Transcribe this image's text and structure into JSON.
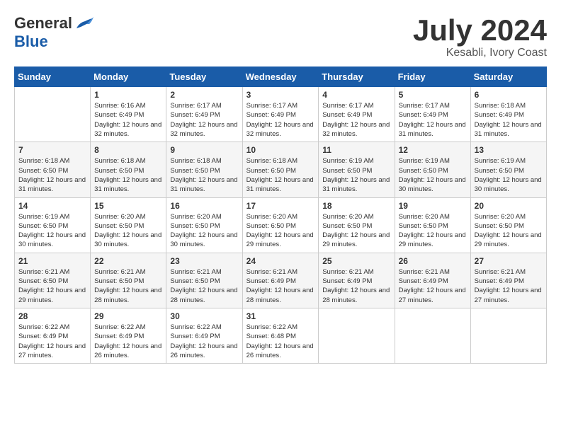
{
  "logo": {
    "general": "General",
    "blue": "Blue"
  },
  "title": {
    "month_year": "July 2024",
    "location": "Kesabli, Ivory Coast"
  },
  "calendar": {
    "headers": [
      "Sunday",
      "Monday",
      "Tuesday",
      "Wednesday",
      "Thursday",
      "Friday",
      "Saturday"
    ],
    "weeks": [
      [
        {
          "day": "",
          "sunrise": "",
          "sunset": "",
          "daylight": ""
        },
        {
          "day": "1",
          "sunrise": "Sunrise: 6:16 AM",
          "sunset": "Sunset: 6:49 PM",
          "daylight": "Daylight: 12 hours and 32 minutes."
        },
        {
          "day": "2",
          "sunrise": "Sunrise: 6:17 AM",
          "sunset": "Sunset: 6:49 PM",
          "daylight": "Daylight: 12 hours and 32 minutes."
        },
        {
          "day": "3",
          "sunrise": "Sunrise: 6:17 AM",
          "sunset": "Sunset: 6:49 PM",
          "daylight": "Daylight: 12 hours and 32 minutes."
        },
        {
          "day": "4",
          "sunrise": "Sunrise: 6:17 AM",
          "sunset": "Sunset: 6:49 PM",
          "daylight": "Daylight: 12 hours and 32 minutes."
        },
        {
          "day": "5",
          "sunrise": "Sunrise: 6:17 AM",
          "sunset": "Sunset: 6:49 PM",
          "daylight": "Daylight: 12 hours and 31 minutes."
        },
        {
          "day": "6",
          "sunrise": "Sunrise: 6:18 AM",
          "sunset": "Sunset: 6:49 PM",
          "daylight": "Daylight: 12 hours and 31 minutes."
        }
      ],
      [
        {
          "day": "7",
          "sunrise": "Sunrise: 6:18 AM",
          "sunset": "Sunset: 6:50 PM",
          "daylight": "Daylight: 12 hours and 31 minutes."
        },
        {
          "day": "8",
          "sunrise": "Sunrise: 6:18 AM",
          "sunset": "Sunset: 6:50 PM",
          "daylight": "Daylight: 12 hours and 31 minutes."
        },
        {
          "day": "9",
          "sunrise": "Sunrise: 6:18 AM",
          "sunset": "Sunset: 6:50 PM",
          "daylight": "Daylight: 12 hours and 31 minutes."
        },
        {
          "day": "10",
          "sunrise": "Sunrise: 6:18 AM",
          "sunset": "Sunset: 6:50 PM",
          "daylight": "Daylight: 12 hours and 31 minutes."
        },
        {
          "day": "11",
          "sunrise": "Sunrise: 6:19 AM",
          "sunset": "Sunset: 6:50 PM",
          "daylight": "Daylight: 12 hours and 31 minutes."
        },
        {
          "day": "12",
          "sunrise": "Sunrise: 6:19 AM",
          "sunset": "Sunset: 6:50 PM",
          "daylight": "Daylight: 12 hours and 30 minutes."
        },
        {
          "day": "13",
          "sunrise": "Sunrise: 6:19 AM",
          "sunset": "Sunset: 6:50 PM",
          "daylight": "Daylight: 12 hours and 30 minutes."
        }
      ],
      [
        {
          "day": "14",
          "sunrise": "Sunrise: 6:19 AM",
          "sunset": "Sunset: 6:50 PM",
          "daylight": "Daylight: 12 hours and 30 minutes."
        },
        {
          "day": "15",
          "sunrise": "Sunrise: 6:20 AM",
          "sunset": "Sunset: 6:50 PM",
          "daylight": "Daylight: 12 hours and 30 minutes."
        },
        {
          "day": "16",
          "sunrise": "Sunrise: 6:20 AM",
          "sunset": "Sunset: 6:50 PM",
          "daylight": "Daylight: 12 hours and 30 minutes."
        },
        {
          "day": "17",
          "sunrise": "Sunrise: 6:20 AM",
          "sunset": "Sunset: 6:50 PM",
          "daylight": "Daylight: 12 hours and 29 minutes."
        },
        {
          "day": "18",
          "sunrise": "Sunrise: 6:20 AM",
          "sunset": "Sunset: 6:50 PM",
          "daylight": "Daylight: 12 hours and 29 minutes."
        },
        {
          "day": "19",
          "sunrise": "Sunrise: 6:20 AM",
          "sunset": "Sunset: 6:50 PM",
          "daylight": "Daylight: 12 hours and 29 minutes."
        },
        {
          "day": "20",
          "sunrise": "Sunrise: 6:20 AM",
          "sunset": "Sunset: 6:50 PM",
          "daylight": "Daylight: 12 hours and 29 minutes."
        }
      ],
      [
        {
          "day": "21",
          "sunrise": "Sunrise: 6:21 AM",
          "sunset": "Sunset: 6:50 PM",
          "daylight": "Daylight: 12 hours and 29 minutes."
        },
        {
          "day": "22",
          "sunrise": "Sunrise: 6:21 AM",
          "sunset": "Sunset: 6:50 PM",
          "daylight": "Daylight: 12 hours and 28 minutes."
        },
        {
          "day": "23",
          "sunrise": "Sunrise: 6:21 AM",
          "sunset": "Sunset: 6:50 PM",
          "daylight": "Daylight: 12 hours and 28 minutes."
        },
        {
          "day": "24",
          "sunrise": "Sunrise: 6:21 AM",
          "sunset": "Sunset: 6:49 PM",
          "daylight": "Daylight: 12 hours and 28 minutes."
        },
        {
          "day": "25",
          "sunrise": "Sunrise: 6:21 AM",
          "sunset": "Sunset: 6:49 PM",
          "daylight": "Daylight: 12 hours and 28 minutes."
        },
        {
          "day": "26",
          "sunrise": "Sunrise: 6:21 AM",
          "sunset": "Sunset: 6:49 PM",
          "daylight": "Daylight: 12 hours and 27 minutes."
        },
        {
          "day": "27",
          "sunrise": "Sunrise: 6:21 AM",
          "sunset": "Sunset: 6:49 PM",
          "daylight": "Daylight: 12 hours and 27 minutes."
        }
      ],
      [
        {
          "day": "28",
          "sunrise": "Sunrise: 6:22 AM",
          "sunset": "Sunset: 6:49 PM",
          "daylight": "Daylight: 12 hours and 27 minutes."
        },
        {
          "day": "29",
          "sunrise": "Sunrise: 6:22 AM",
          "sunset": "Sunset: 6:49 PM",
          "daylight": "Daylight: 12 hours and 26 minutes."
        },
        {
          "day": "30",
          "sunrise": "Sunrise: 6:22 AM",
          "sunset": "Sunset: 6:49 PM",
          "daylight": "Daylight: 12 hours and 26 minutes."
        },
        {
          "day": "31",
          "sunrise": "Sunrise: 6:22 AM",
          "sunset": "Sunset: 6:48 PM",
          "daylight": "Daylight: 12 hours and 26 minutes."
        },
        {
          "day": "",
          "sunrise": "",
          "sunset": "",
          "daylight": ""
        },
        {
          "day": "",
          "sunrise": "",
          "sunset": "",
          "daylight": ""
        },
        {
          "day": "",
          "sunrise": "",
          "sunset": "",
          "daylight": ""
        }
      ]
    ]
  }
}
